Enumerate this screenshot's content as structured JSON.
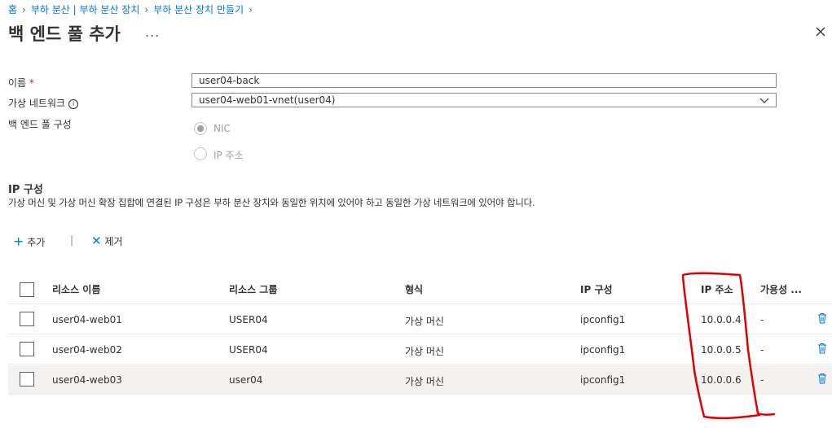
{
  "breadcrumb": [
    "홈",
    "부하 분산 | 부하 분산 장치",
    "부하 분산 장치 만들기"
  ],
  "page_title": "백 엔드 풀 추가",
  "more_label": "...",
  "form": {
    "name_label": "이름",
    "name_required": "*",
    "name_value": "user04-back",
    "vnet_label": "가상 네트워크",
    "vnet_info": "i",
    "vnet_value": "user04-web01-vnet(user04)",
    "pool_config_label": "백 엔드 풀 구성",
    "options": [
      "NIC",
      "IP 주소"
    ],
    "selected_option": "NIC"
  },
  "ip_section": {
    "title": "IP 구성",
    "description": "가상 머신 및 가상 머신 확장 집합에 연결된 IP 구성은 부하 분산 장치와 동일한 위치에 있어야 하고 동일한 가상 네트워크에 있어야 합니다."
  },
  "toolbar": {
    "add_label": "추가",
    "remove_label": "제거",
    "separator": "|"
  },
  "table": {
    "columns": [
      "리소스 이름",
      "리소스 그룹",
      "형식",
      "IP 구성",
      "IP 주소",
      "가용성 ..."
    ],
    "rows": [
      {
        "name": "user04-web01",
        "group": "USER04",
        "type": "가상 머신",
        "ipconfig": "ipconfig1",
        "ip": "10.0.0.4",
        "availability": "-"
      },
      {
        "name": "user04-web02",
        "group": "USER04",
        "type": "가상 머신",
        "ipconfig": "ipconfig1",
        "ip": "10.0.0.5",
        "availability": "-"
      },
      {
        "name": "user04-web03",
        "group": "user04",
        "type": "가상 머신",
        "ipconfig": "ipconfig1",
        "ip": "10.0.0.6",
        "availability": "-"
      }
    ]
  },
  "colors": {
    "link": "#0078d4",
    "annotation": "#e00000",
    "selected_row": "#f3f2f1"
  }
}
